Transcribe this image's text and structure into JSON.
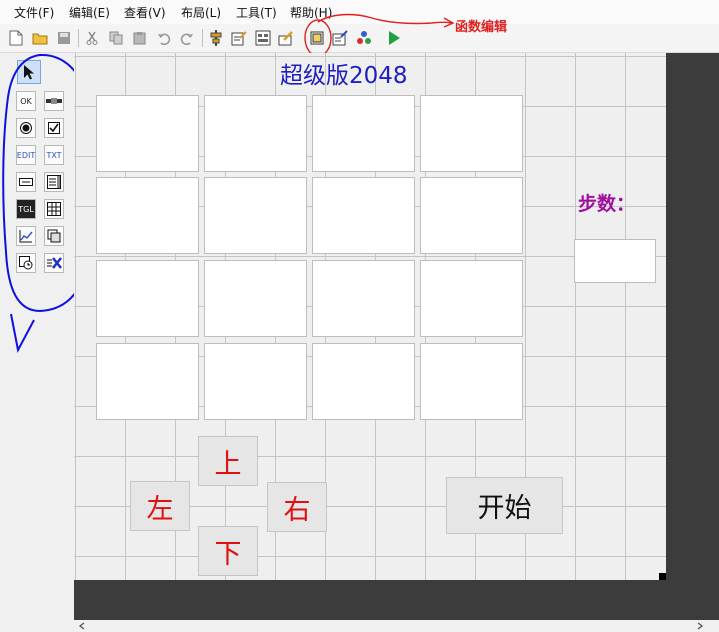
{
  "menu": [
    "文件(F)",
    "编辑(E)",
    "查看(V)",
    "布局(L)",
    "工具(T)",
    "帮助(H)"
  ],
  "annotation_label": "函数编辑",
  "form": {
    "title": "超级版2048",
    "steps_label": "步数：",
    "buttons": {
      "up": "上",
      "left": "左",
      "right": "右",
      "down": "下",
      "start": "开始"
    }
  },
  "palette_tools": [
    "pointer",
    "OK",
    "scrollbar",
    "radio",
    "checkbox",
    "EDIT",
    "TXT",
    "listbox",
    "textfield",
    "TGL",
    "grid",
    "chart",
    "image",
    "timer",
    "formula"
  ],
  "colors": {
    "title": "#2020c0",
    "steps_label": "#a010a0",
    "direction_buttons": "#e01010",
    "annotation": "#e02020",
    "annotation_circle": "#1010e0"
  }
}
